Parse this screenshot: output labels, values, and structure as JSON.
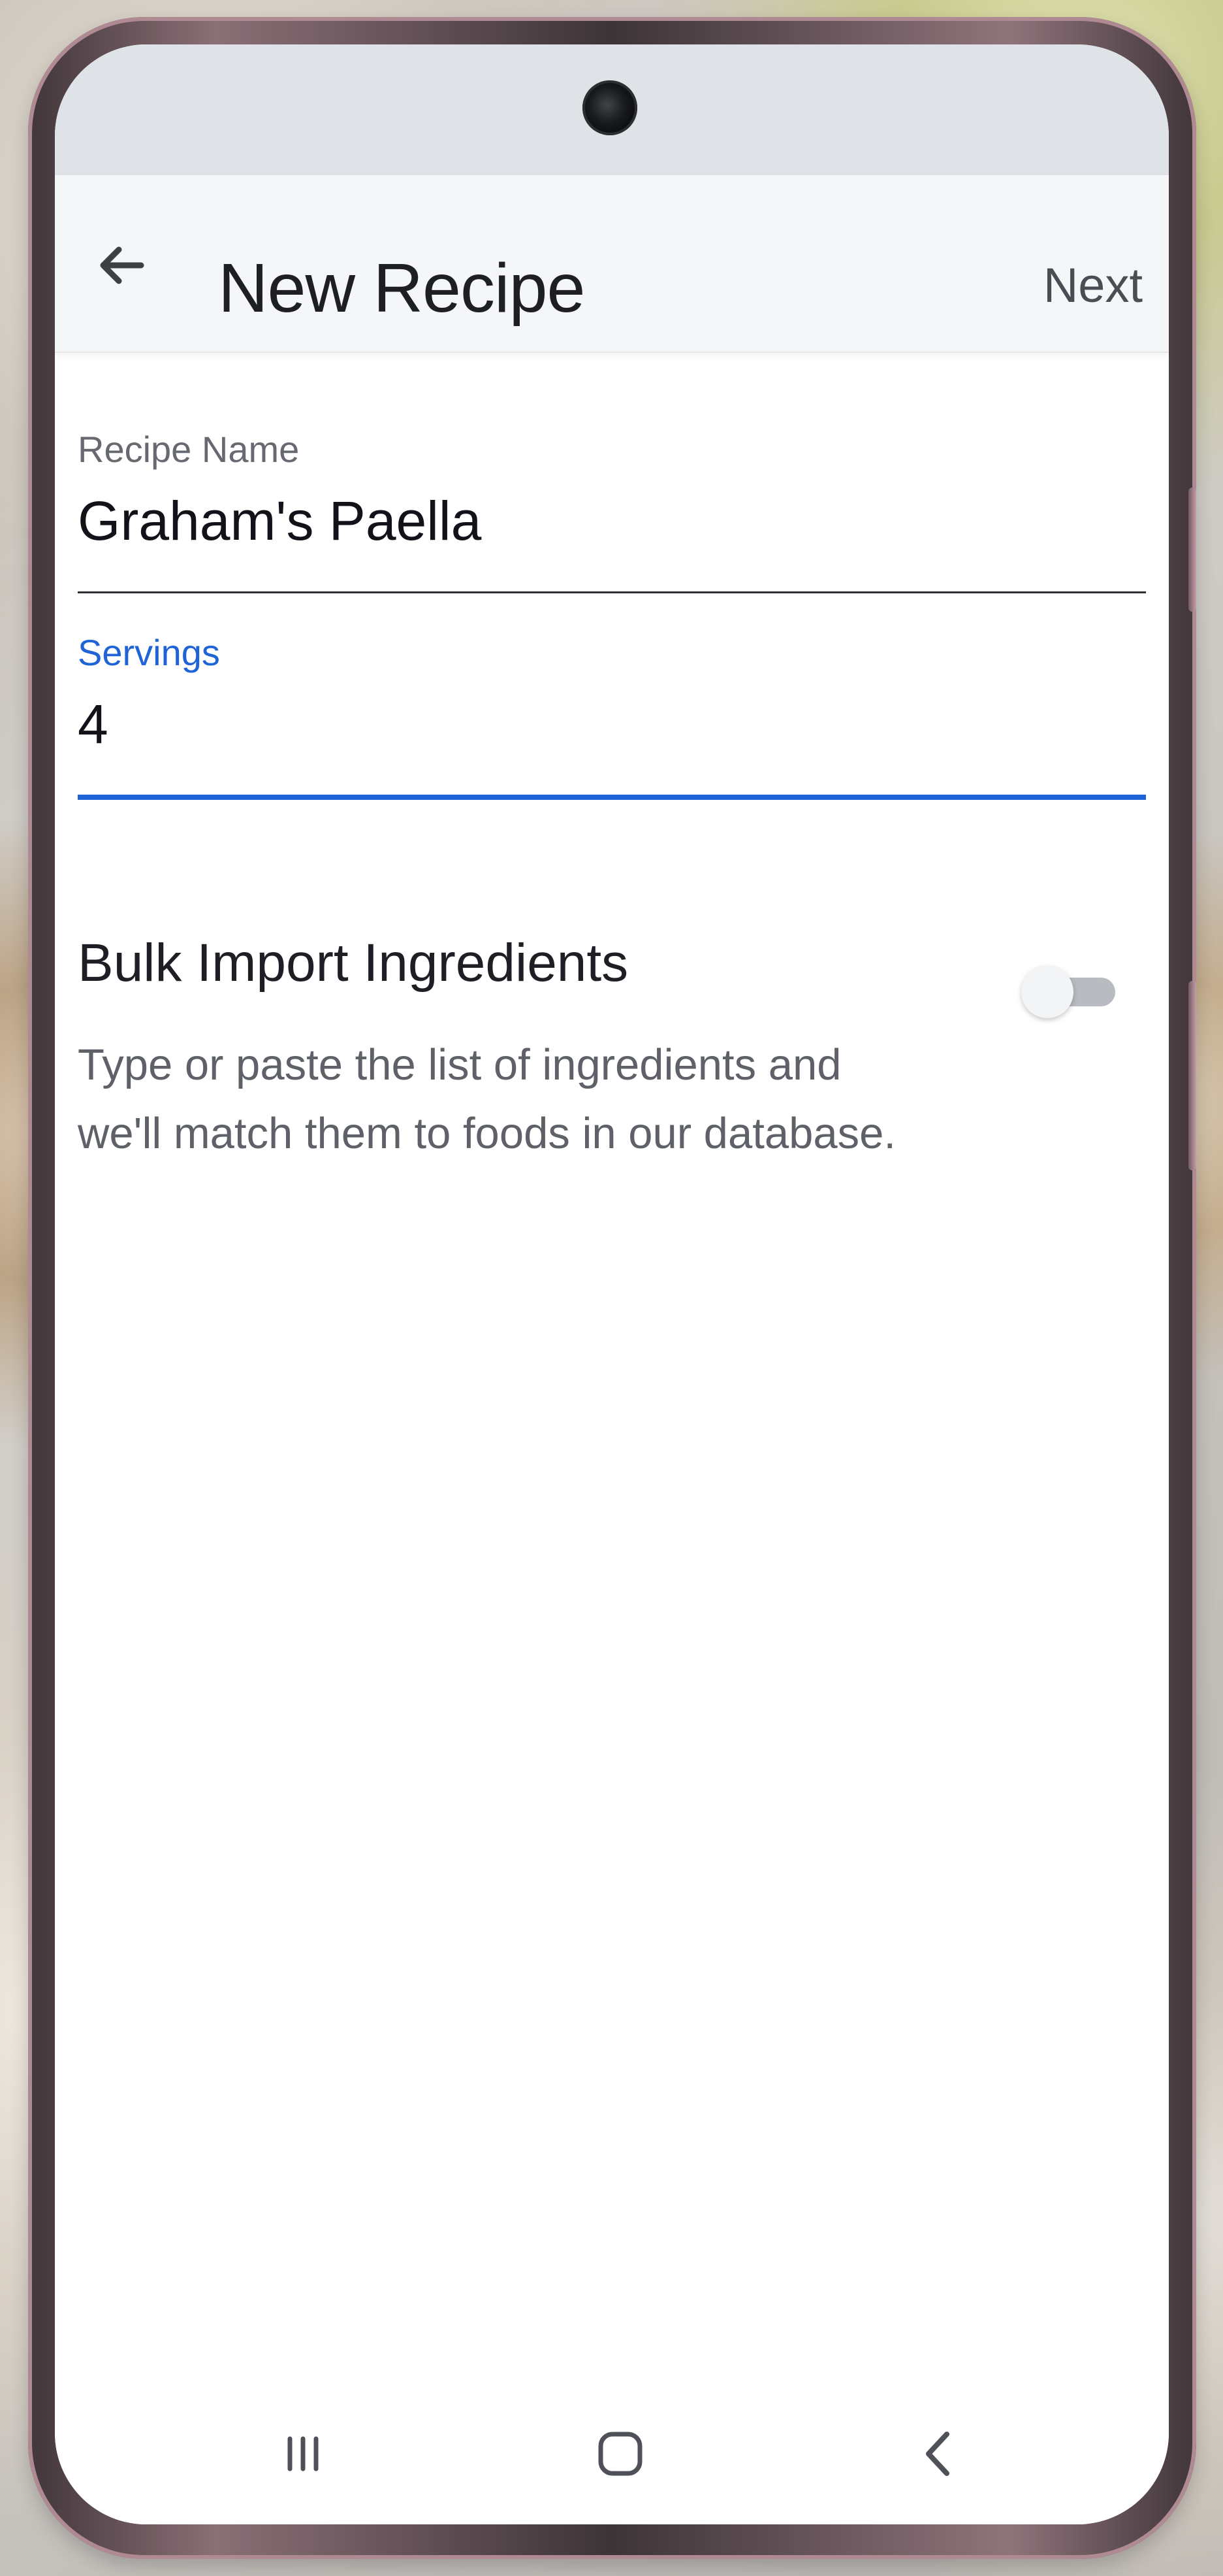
{
  "app": {
    "title": "New Recipe",
    "next_label": "Next"
  },
  "form": {
    "recipe_name": {
      "label": "Recipe Name",
      "value": "Graham's Paella"
    },
    "servings": {
      "label": "Servings",
      "value": "4"
    }
  },
  "bulk_import": {
    "title": "Bulk Import Ingredients",
    "description": "Type or paste the list of ingredients and we'll match them to foods in our database.",
    "enabled": false
  },
  "colors": {
    "accent": "#1f63d6",
    "text_primary": "#1e1f24",
    "text_secondary": "#5e6167",
    "app_bar_background": "#f5f6f7"
  },
  "icons": {
    "back": "arrow-left-icon",
    "recents": "recents-icon",
    "home": "home-icon",
    "system_back": "chevron-left-icon"
  }
}
